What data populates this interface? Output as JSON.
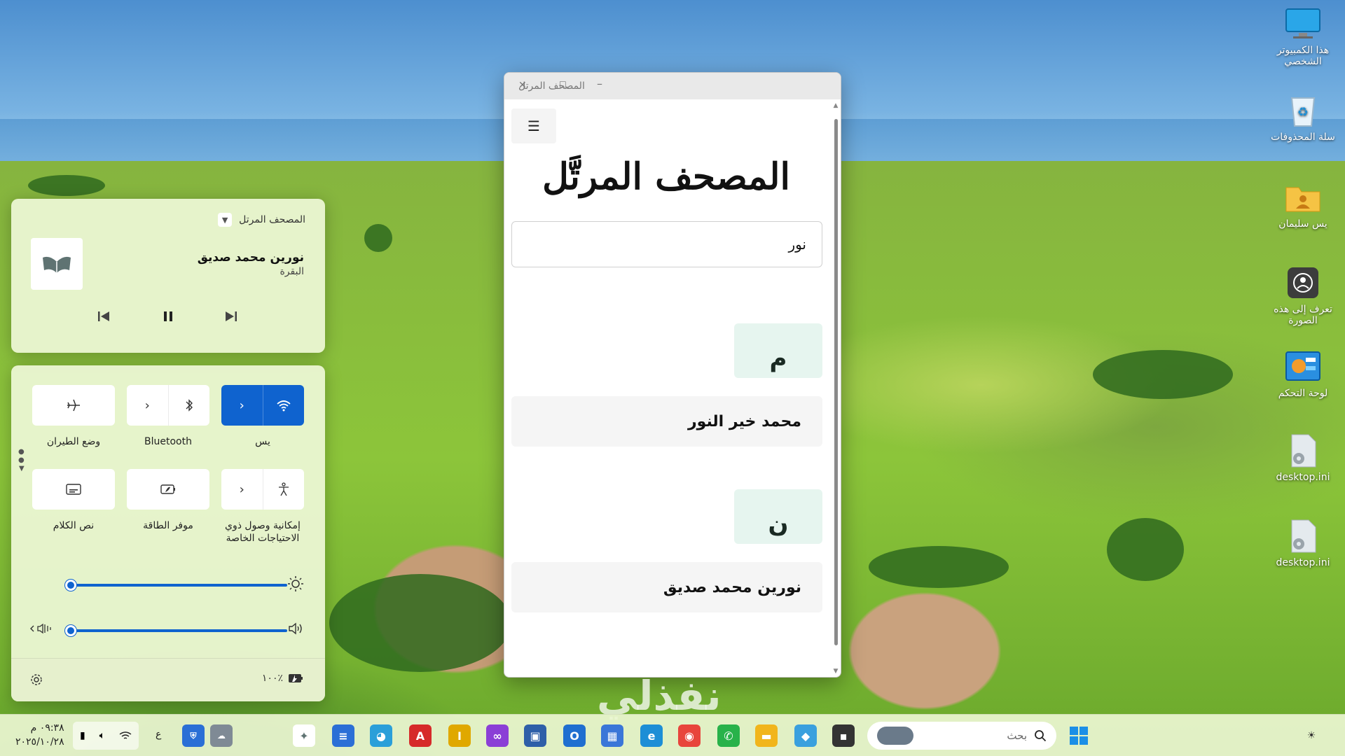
{
  "desktop": {
    "icons": [
      {
        "label": "هذا الكمبيوتر الشخصي",
        "icon": "monitor-icon"
      },
      {
        "label": "سلة المحذوفات",
        "icon": "recycle-bin-icon"
      },
      {
        "label": "يس سليمان",
        "icon": "user-folder-icon"
      },
      {
        "label": "تعرف إلى هذه الصورة",
        "icon": "camera-info-icon"
      },
      {
        "label": "لوحة التحكم",
        "icon": "control-panel-icon"
      },
      {
        "label": "desktop.ini",
        "icon": "settings-file-icon"
      },
      {
        "label": "desktop.ini",
        "icon": "settings-file-icon"
      }
    ]
  },
  "media": {
    "app_name": "المصحف المرتل",
    "track_title": "نورين محمد صديق",
    "track_subtitle": "البقرة"
  },
  "quick_settings": {
    "tiles": [
      {
        "label": "يس",
        "icon": "wifi-icon",
        "active": true
      },
      {
        "label": "Bluetooth",
        "icon": "bluetooth-icon",
        "active": false
      },
      {
        "label": "وضع الطيران",
        "icon": "airplane-icon",
        "active": false
      },
      {
        "label": "إمكانية وصول ذوي الاحتياجات الخاصة",
        "icon": "accessibility-icon",
        "active": false
      },
      {
        "label": "موفر الطاقة",
        "icon": "battery-saver-icon",
        "active": false
      },
      {
        "label": "نص الكلام",
        "icon": "live-captions-icon",
        "active": false
      }
    ],
    "brightness": 0.0,
    "volume": 0.0,
    "battery_text": "١٠٠٪"
  },
  "window": {
    "title": "المصحف المرتل",
    "heading": "المصحف المرتَّل",
    "search_value": "نور",
    "groups": [
      {
        "letter": "م",
        "items": [
          "محمد خير النور"
        ]
      },
      {
        "letter": "ن",
        "items": [
          "نورين محمد صديق"
        ]
      }
    ]
  },
  "taskbar": {
    "search_placeholder": "بحث",
    "time": "٠٩:٣٨ م",
    "date": "٢٠٢٥/١٠/٢٨",
    "language": "ع"
  },
  "watermark": "نفذلي"
}
